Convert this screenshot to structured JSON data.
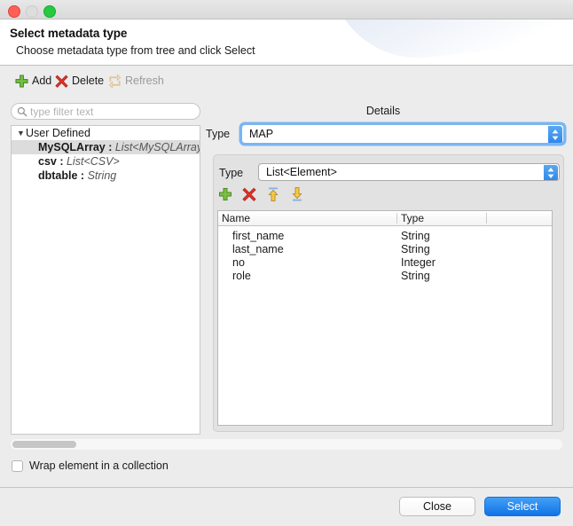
{
  "window": {
    "traffic_lights": {
      "close_color": "#ff5f57",
      "minimize_color": "#dddddd",
      "zoom_color": "#28c840"
    }
  },
  "header": {
    "title": "Select metadata type",
    "subtitle": "Choose metadata type from tree and click Select"
  },
  "toolbar": {
    "add_label": "Add",
    "delete_label": "Delete",
    "refresh_label": "Refresh"
  },
  "filter": {
    "placeholder": "type filter text",
    "value": ""
  },
  "tree": {
    "root": {
      "label": "User Defined",
      "expanded": true
    },
    "items": [
      {
        "name": "MySQLArray",
        "separator": " : ",
        "type": "List<MySQLArray>",
        "selected": true
      },
      {
        "name": "csv",
        "separator": " : ",
        "type": "List<CSV>",
        "selected": false
      },
      {
        "name": "dbtable",
        "separator": " : ",
        "type": "String",
        "selected": false
      }
    ]
  },
  "details": {
    "title": "Details",
    "outer_type": {
      "label": "Type",
      "value": "MAP",
      "focused": true
    },
    "inner_type": {
      "label": "Type",
      "value": "List<Element>",
      "focused": false
    },
    "mini_toolbar": [
      {
        "icon": "plus-icon",
        "color": "#5aa832"
      },
      {
        "icon": "delete-x-icon",
        "color": "#d93025"
      },
      {
        "icon": "move-to-top-icon",
        "color": "#f0b429"
      },
      {
        "icon": "move-to-bottom-icon",
        "color": "#f0b429"
      }
    ],
    "table": {
      "columns": [
        "Name",
        "Type",
        ""
      ],
      "rows": [
        {
          "name": "first_name",
          "type": "String"
        },
        {
          "name": "last_name",
          "type": "String"
        },
        {
          "name": "no",
          "type": "Integer"
        },
        {
          "name": "role",
          "type": "String"
        }
      ]
    }
  },
  "options": {
    "wrap_label": "Wrap element in a collection",
    "wrap_checked": false
  },
  "footer": {
    "close_label": "Close",
    "select_label": "Select",
    "accent_color": "#1273e8"
  }
}
